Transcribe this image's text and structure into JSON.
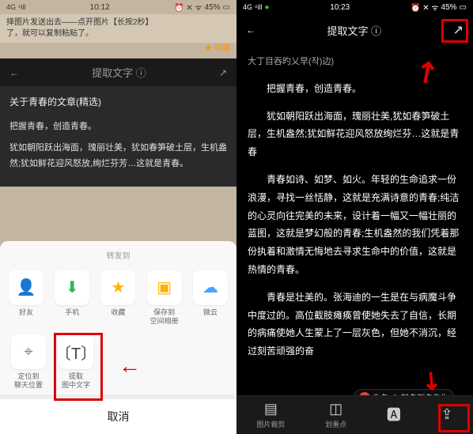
{
  "left": {
    "status": {
      "signal": "4G ⁴ill",
      "time": "10:12",
      "icons": "⏰ ✕ ᯤ",
      "battery": "45%",
      "batt_icon": "▭"
    },
    "hint_line1": "择图片发送出去——点开图片【长按2秒】",
    "hint_line2": "了，就可以复制粘贴了。",
    "bookmark": "★ 收藏",
    "ocr_header": {
      "back": "←",
      "title": "提取文字 ⓘ",
      "share": "↗"
    },
    "preview": {
      "title": "关于青春的文章(精选)",
      "p1": "把握青春，创造青春。",
      "p2": "犹如朝阳跃出海面，瑰丽壮美，犹如春笋破土层，生机盎然;犹如鲜花迎风怒放,绚烂芬芳…这就是青春。"
    },
    "sheet": {
      "title": "转发到",
      "row1": [
        {
          "icon": "👤",
          "color": "#4aa3ff",
          "label": "好友"
        },
        {
          "icon": "⬇",
          "color": "#2fb84c",
          "label": "手机"
        },
        {
          "icon": "★",
          "color": "#ffb300",
          "label": "收藏"
        },
        {
          "icon": "▣",
          "color": "#ffb300",
          "label": "保存到\n空间相册"
        },
        {
          "icon": "☁",
          "color": "#4aa3ff",
          "label": "微云"
        }
      ],
      "row2": [
        {
          "icon": "⌖",
          "color": "#888",
          "label": "定位到\n聊天位置"
        },
        {
          "icon": "〔T〕",
          "color": "#444",
          "label": "提取\n图中文字"
        }
      ],
      "cancel": "取消"
    }
  },
  "right": {
    "status": {
      "signal": "4G ⁴ill",
      "wechat": "●",
      "time": "10:23",
      "icons": "⏰ ✕ ᯤ",
      "battery": "45%",
      "batt_icon": "▭"
    },
    "ocr_header": {
      "back": "←",
      "title": "提取文字 ⓘ",
      "share": "↗"
    },
    "snippet": "大丁目吞旳乂早(작)边)",
    "p1": "把握青春，创造青春。",
    "p2": "犹如朝阳跃出海面，瑰丽壮美,犹如春笋破土层，生机盎然;犹如鲜花迎风怒放绚烂芬…这就是青春",
    "p3": "青春如诗、如梦、如火。年轻的生命追求一份浪漫，寻找一丝恬静，这就是充满诗意的青春;纯洁的心灵向往完美的未来，设计着一幅又一幅壮丽的蓝图，这就是梦幻般的青春;生机盎然的我们凭着那份执着和激情无悔地去寻求生命中的价值，这就是热情的青春。",
    "p4": "青春是壮美的。张海迪的一生是在与病魔斗争中度过的。高位截肢瘫痪曾使她失去了自信，长期的病痛使她人生蒙上了一层灰色，但她不消沉，经过刻苦顽强的奋",
    "nav": [
      {
        "icon": "▤",
        "label": "图片裁剪"
      },
      {
        "icon": "◫",
        "label": "划重点"
      },
      {
        "icon": "🅰",
        "label": ""
      },
      {
        "icon": "⇪",
        "label": ""
      }
    ],
    "watermark": {
      "prefix": "头条",
      "name": "@ 起名测名先生"
    }
  }
}
